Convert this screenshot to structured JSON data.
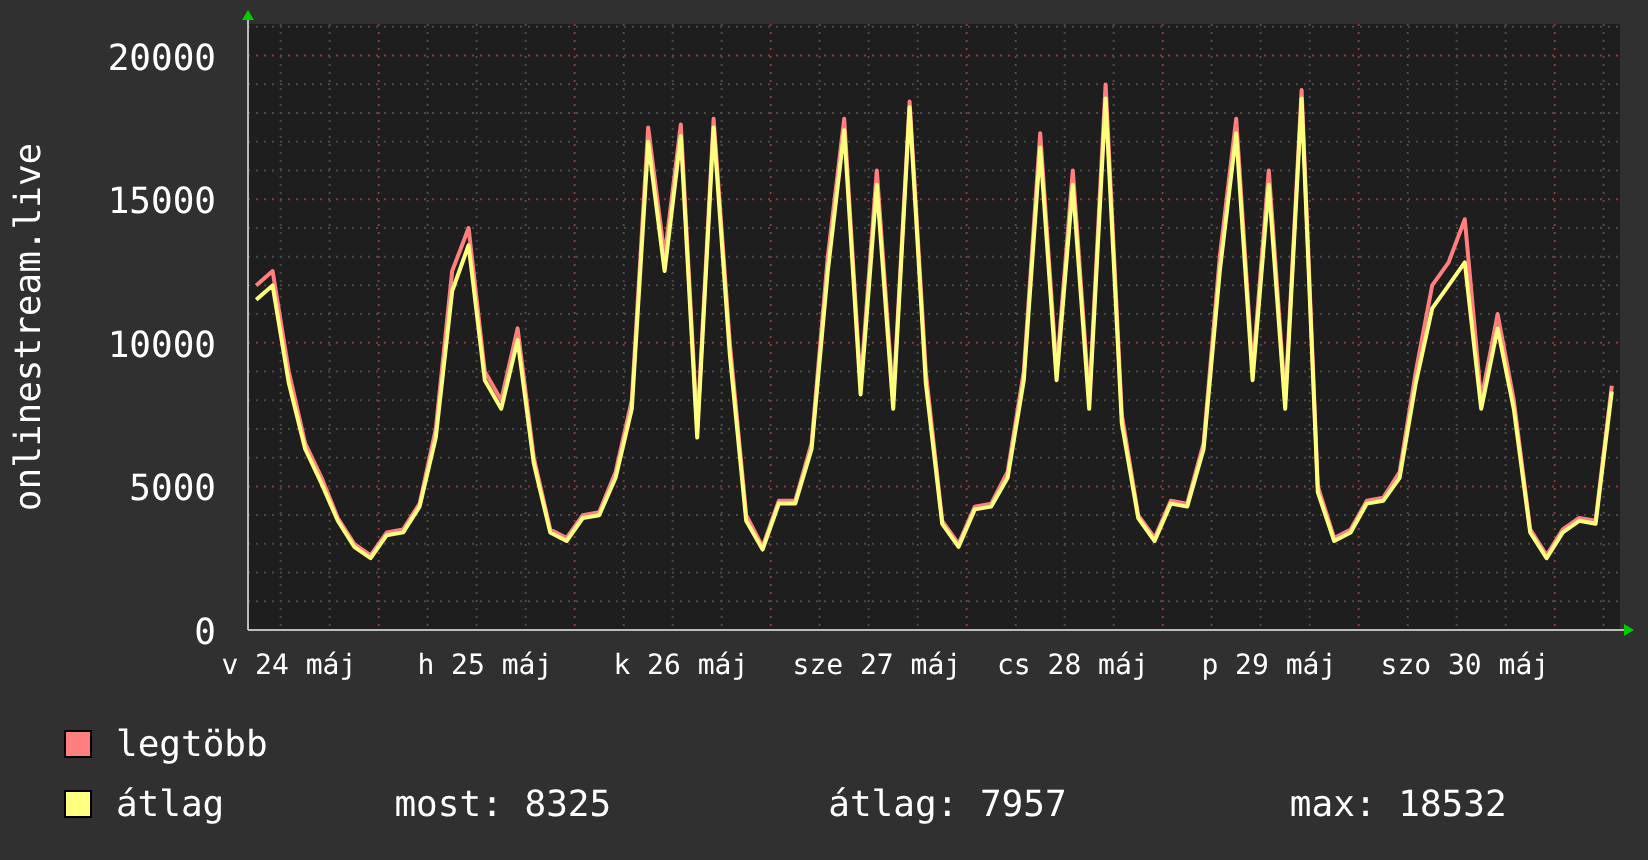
{
  "chart_data": {
    "type": "line",
    "grid": true,
    "ylabel": "onlinestream.live",
    "ylim": [
      0,
      21100
    ],
    "yticks": [
      0,
      5000,
      10000,
      15000,
      20000
    ],
    "categories": [
      null,
      null,
      "v 24 máj",
      null,
      null,
      null,
      null,
      null,
      null,
      null,
      null,
      null,
      null,
      null,
      "h 25 máj",
      null,
      null,
      null,
      null,
      null,
      null,
      null,
      null,
      null,
      null,
      null,
      "k 26 máj",
      null,
      null,
      null,
      null,
      null,
      null,
      null,
      null,
      null,
      null,
      null,
      "sze 27 máj",
      null,
      null,
      null,
      null,
      null,
      null,
      null,
      null,
      null,
      null,
      null,
      "cs 28 máj",
      null,
      null,
      null,
      null,
      null,
      null,
      null,
      null,
      null,
      null,
      null,
      "p 29 máj",
      null,
      null,
      null,
      null,
      null,
      null,
      null,
      null,
      null,
      null,
      null,
      "szo 30 máj",
      null,
      null,
      null,
      null,
      null,
      null,
      null,
      null,
      null
    ],
    "series": [
      {
        "name": "legtöbb",
        "color": "#ff7f7f",
        "values": [
          12000,
          12500,
          9000,
          6500,
          5300,
          3900,
          3000,
          2600,
          3400,
          3500,
          4400,
          7000,
          12500,
          14000,
          9000,
          8000,
          10500,
          6000,
          3500,
          3200,
          4000,
          4100,
          5500,
          8000,
          17500,
          13000,
          17600,
          7000,
          17800,
          10000,
          4000,
          2900,
          4500,
          4500,
          6500,
          13000,
          17800,
          8500,
          16000,
          8000,
          18400,
          9000,
          3800,
          3000,
          4300,
          4400,
          5500,
          9000,
          17300,
          9000,
          16000,
          8000,
          19000,
          7500,
          4000,
          3200,
          4500,
          4400,
          6500,
          13000,
          17800,
          9000,
          16000,
          8000,
          18800,
          5000,
          3200,
          3500,
          4500,
          4600,
          5500,
          9000,
          12000,
          12800,
          14300,
          8000,
          11000,
          8000,
          3500,
          2600,
          3500,
          3900,
          3800,
          8500
        ]
      },
      {
        "name": "átlag",
        "color": "#ffff7f",
        "values": [
          11500,
          12000,
          8600,
          6300,
          5100,
          3800,
          2900,
          2500,
          3300,
          3400,
          4300,
          6700,
          11800,
          13400,
          8700,
          7700,
          10100,
          5800,
          3400,
          3100,
          3900,
          4000,
          5300,
          7700,
          17000,
          12500,
          17200,
          6700,
          17500,
          9600,
          3800,
          2800,
          4400,
          4400,
          6300,
          12500,
          17400,
          8200,
          15500,
          7700,
          18200,
          8600,
          3700,
          2900,
          4200,
          4300,
          5300,
          8700,
          16800,
          8700,
          15500,
          7700,
          18500,
          7200,
          3900,
          3100,
          4400,
          4300,
          6300,
          12500,
          17300,
          8700,
          15500,
          7700,
          18500,
          4800,
          3100,
          3400,
          4400,
          4500,
          5300,
          8600,
          11200,
          12000,
          12800,
          7700,
          10500,
          7700,
          3400,
          2500,
          3400,
          3800,
          3700,
          8300
        ]
      }
    ]
  },
  "stats": [
    "most: 8325",
    "átlag: 7957",
    "max: 18532"
  ]
}
